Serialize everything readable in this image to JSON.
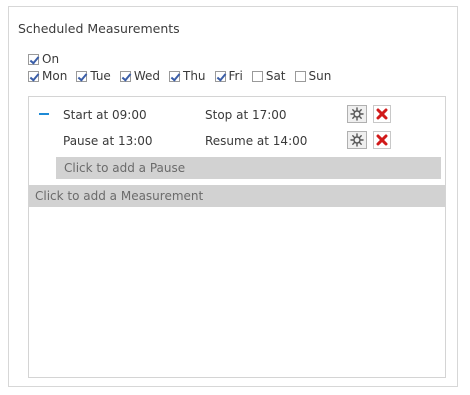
{
  "panel": {
    "title": "Scheduled Measurements"
  },
  "enable": {
    "label": "On",
    "checked": true
  },
  "days": [
    {
      "label": "Mon",
      "checked": true
    },
    {
      "label": "Tue",
      "checked": true
    },
    {
      "label": "Wed",
      "checked": true
    },
    {
      "label": "Thu",
      "checked": true
    },
    {
      "label": "Fri",
      "checked": true
    },
    {
      "label": "Sat",
      "checked": false
    },
    {
      "label": "Sun",
      "checked": false
    }
  ],
  "measurement": {
    "start": "Start at 09:00",
    "stop": "Stop at 17:00",
    "pause": {
      "start": "Pause at 13:00",
      "resume": "Resume at 14:00"
    },
    "add_pause": "Click to add a Pause"
  },
  "add_measurement": "Click to add a Measurement",
  "colors": {
    "check": "#3b5ea8",
    "collapse": "#1e8ad6",
    "delete": "#d11a1a",
    "add_bar": "#d2d2d2"
  },
  "icons": {
    "collapse": "minus-icon",
    "settings": "gear-icon",
    "delete": "red-x-icon"
  }
}
